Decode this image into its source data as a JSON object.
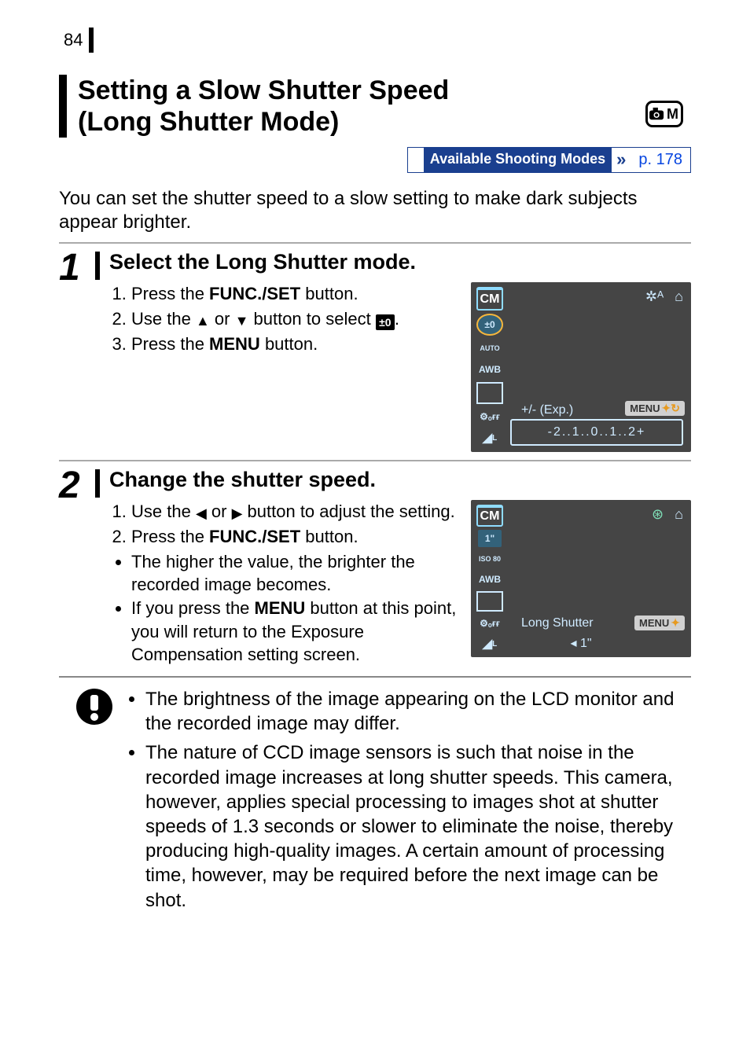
{
  "page_number": "84",
  "title_line1": "Setting a Slow Shutter Speed",
  "title_line2": "(Long Shutter Mode)",
  "mode_icon_letter": "M",
  "available_modes_label": "Available Shooting Modes",
  "available_modes_link": "p. 178",
  "intro": "You can set the shutter speed to a slow setting to make dark subjects appear brighter.",
  "step1": {
    "number": "1",
    "heading": "Select the Long Shutter mode.",
    "items": {
      "i1_pre": "Press the ",
      "i1_btn": "FUNC./SET",
      "i1_post": " button.",
      "i2_pre": "Use the ",
      "i2_mid": " or ",
      "i2_post": " button to select ",
      "i2_end": ".",
      "i2_icon_text": "±0",
      "i3_pre": "Press the ",
      "i3_btn": "MENU",
      "i3_post": " button."
    },
    "screenshot": {
      "top_right_1": "✲ᴬ",
      "top_right_2": "⌂",
      "sidebar_cm": "CM",
      "sidebar_sub": "±0",
      "sidebar_auto": "AUTO",
      "sidebar_awb": "AWB",
      "label": "+/- (Exp.)",
      "menu": "MENU",
      "bottom_scale": "-2..1..0..1..2+"
    }
  },
  "step2": {
    "number": "2",
    "heading": "Change the shutter speed.",
    "items": {
      "i1_pre": "Use the ",
      "i1_mid": " or ",
      "i1_post": " button to adjust the setting.",
      "i2_pre": "Press the ",
      "i2_btn": "FUNC./SET",
      "i2_post": " button.",
      "b1": "The higher the value, the brighter the recorded image becomes.",
      "b2_pre": "If you press the ",
      "b2_btn": "MENU",
      "b2_post": " button at this point, you will return to the Exposure Compensation setting screen."
    },
    "screenshot": {
      "top_right_1": "⊛",
      "top_right_2": "⌂",
      "sidebar_cm": "CM",
      "sidebar_sub": "1\"",
      "sidebar_iso": "ISO 80",
      "sidebar_awb": "AWB",
      "label": "Long Shutter",
      "menu": "MENU",
      "bottom": "◂ 1\""
    }
  },
  "caution": {
    "item1": "The brightness of the image appearing on the LCD monitor and the recorded image may differ.",
    "item2": "The nature of CCD image sensors is such that noise in the recorded image increases at long shutter speeds. This camera, however, applies special processing to images shot at shutter speeds of 1.3 seconds or slower to eliminate the noise, thereby producing high-quality images. A certain amount of processing time, however, may be required before the next image can be shot."
  }
}
